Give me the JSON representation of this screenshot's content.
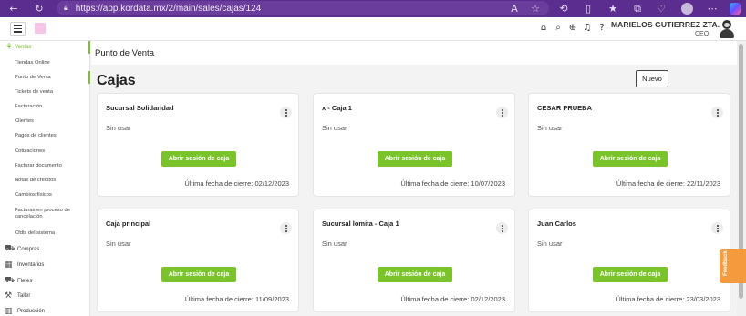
{
  "browser": {
    "url": "https://app.kordata.mx/2/main/sales/cajas/124"
  },
  "header": {
    "user_name": "MARIELOS GUTIERREZ ZTA.",
    "user_role": "CEO"
  },
  "sidebar": {
    "section": "Ventas",
    "sub_items": [
      "Tiendas Online",
      "Punto de Venta",
      "Tickets de venta",
      "Facturación",
      "Clientes",
      "Pagos de clientes",
      "Cotizaciones",
      "Facturar documento",
      "Notas de créditos",
      "Cambios físicos",
      "Facturas en proceso de cancelación",
      "Cfdis del sistema"
    ],
    "main_items": [
      "Compras",
      "Inventarios",
      "Fletes",
      "Taller",
      "Producción"
    ]
  },
  "main": {
    "section_title": "Punto de Venta",
    "page_title": "Cajas",
    "new_button": "Nuevo"
  },
  "cards": [
    {
      "name": "Sucursal Solidaridad",
      "status": "Sin usar",
      "button": "Abrir sesión de caja",
      "last_close": "Última fecha de cierre: 02/12/2023"
    },
    {
      "name": "x - Caja 1",
      "status": "Sin usar",
      "button": "Abrir sesión de caja",
      "last_close": "Última fecha de cierre: 10/07/2023"
    },
    {
      "name": "CESAR PRUEBA",
      "status": "Sin usar",
      "button": "Abrir sesión de caja",
      "last_close": "Última fecha de cierre: 22/11/2023"
    },
    {
      "name": "Caja principal",
      "status": "Sin usar",
      "button": "Abrir sesión de caja",
      "last_close": "Última fecha de cierre: 11/09/2023"
    },
    {
      "name": "Sucursal lomita - Caja 1",
      "status": "Sin usar",
      "button": "Abrir sesión de caja",
      "last_close": "Última fecha de cierre: 02/12/2023"
    },
    {
      "name": "Juan Carlos",
      "status": "Sin usar",
      "button": "Abrir sesión de caja",
      "last_close": "Última fecha de cierre: 23/03/2023"
    }
  ],
  "feedback_label": "Feedback",
  "colors": {
    "accent": "#7ac32a",
    "browser": "#5b2d8e",
    "feedback": "#f59a3d"
  },
  "icons": [
    "back-icon",
    "refresh-icon",
    "lock-icon",
    "store-icon",
    "search-icon",
    "add-icon",
    "bell-icon",
    "help-icon",
    "more-icon"
  ]
}
